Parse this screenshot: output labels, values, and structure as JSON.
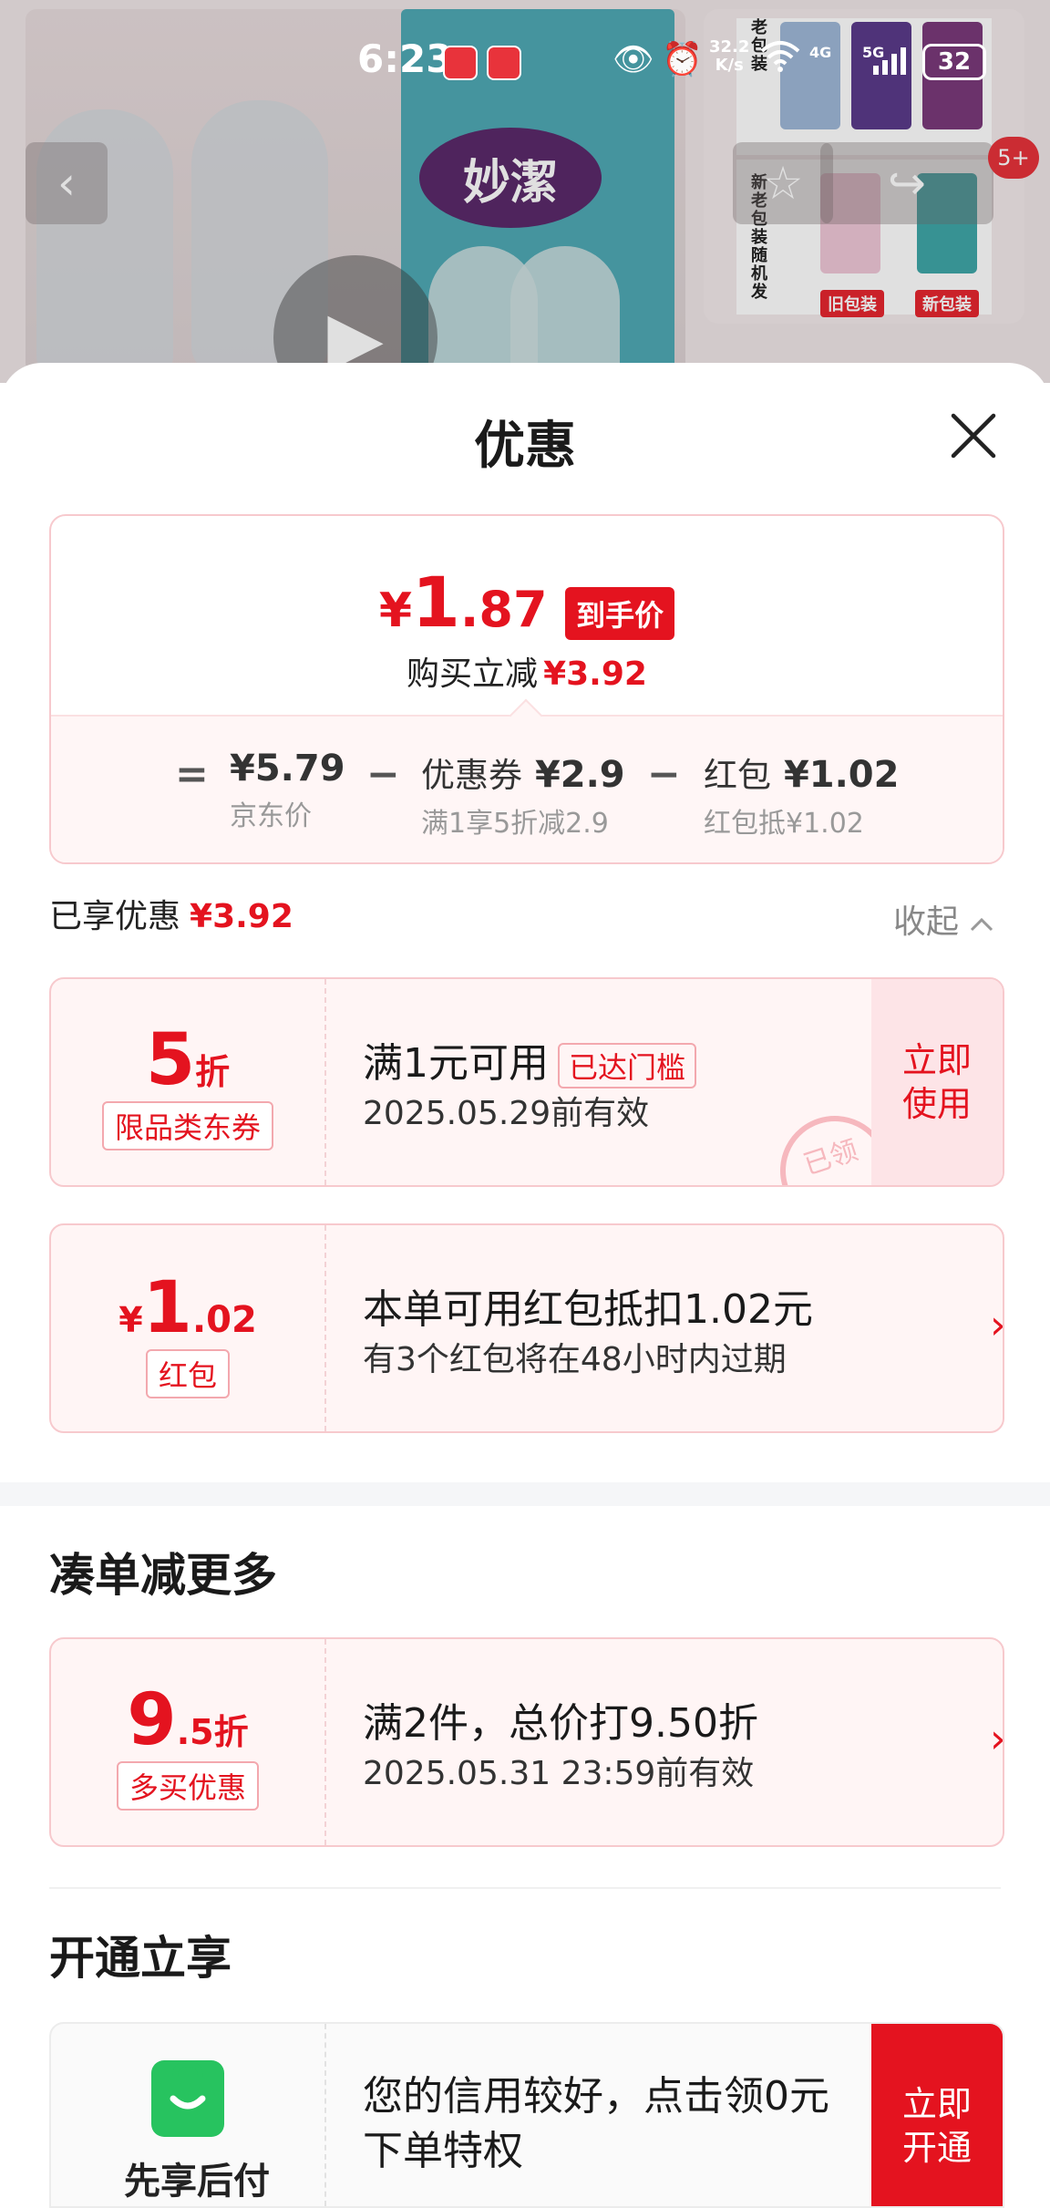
{
  "status_bar": {
    "time": "6:23",
    "net_speed_value": "32.2",
    "net_speed_unit": "K/s",
    "signal_4g": "4G",
    "signal_5g": "5G",
    "battery": "32",
    "icons": [
      "eye-icon",
      "alarm-icon",
      "wifi-icon",
      "signal-icon",
      "battery-icon"
    ]
  },
  "background": {
    "brand_text": "妙潔",
    "side_text_top": "老包装",
    "side_text_bottom": "新老包装随机发",
    "old_pack_tag": "旧包装",
    "new_pack_tag": "新包装",
    "image_count_badge": "5+"
  },
  "sheet": {
    "title": "优惠",
    "summary": {
      "price_yen": "¥",
      "price_int": "1",
      "price_dec": ".87",
      "price_tag": "到手价",
      "reduce_label": "购买立减",
      "reduce_value": "¥3.92",
      "equals": "=",
      "jd_price": "¥5.79",
      "jd_price_label": "京东价",
      "minus": "−",
      "coupon_label": "优惠券",
      "coupon_value": "¥2.9",
      "coupon_sub": "满1享5折减2.9",
      "redpack_label": "红包",
      "redpack_value": "¥1.02",
      "redpack_sub": "红包抵¥1.02"
    },
    "enjoyed_label": "已享优惠",
    "enjoyed_value": "¥3.92",
    "collapse_label": "收起",
    "coupons": [
      {
        "amount": "5",
        "unit": "折",
        "tag": "限品类东券",
        "title": "满1元可用",
        "reached": "已达门槛",
        "validity": "2025.05.29前有效",
        "action": "立即使用",
        "stamp": "已领"
      },
      {
        "yen": "¥",
        "amount": "1",
        "decimal": ".02",
        "tag": "红包",
        "title": "本单可用红包抵扣1.02元",
        "validity": "有3个红包将在48小时内过期"
      }
    ],
    "more_section_title": "凑单减更多",
    "more_coupon": {
      "amount": "9",
      "decimal": ".5折",
      "tag": "多买优惠",
      "title": "满2件，总价打9.50折",
      "validity": "2025.05.31 23:59前有效"
    },
    "open_section_title": "开通立享",
    "credit": {
      "label": "先享后付",
      "text": "您的信用较好，点击领0元下单特权",
      "action": "立即开通"
    }
  }
}
